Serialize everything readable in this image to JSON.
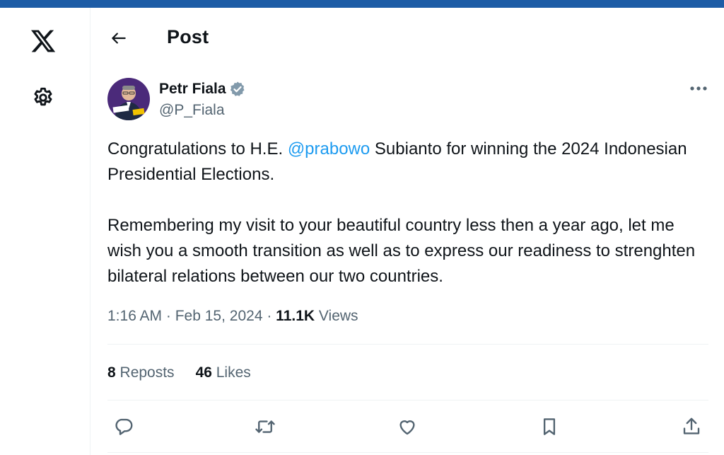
{
  "app": {
    "logo_icon": "x-logo-icon",
    "settings_icon": "gear-icon",
    "accent_color": "#1d9bf0",
    "topbar_color": "#1d5ca6"
  },
  "header": {
    "back_icon": "arrow-left-icon",
    "title": "Post"
  },
  "author": {
    "name": "Petr Fiala",
    "handle": "@P_Fiala",
    "verified": true,
    "verified_color": "#829aab"
  },
  "tweet": {
    "text_before_mention": "Congratulations to H.E. ",
    "mention": "@prabowo",
    "text_after_mention": " Subianto for winning the 2024 Indonesian Presidential Elections.",
    "paragraph_2": "Remembering my visit to your beautiful country less then a year ago, let me wish you a smooth transition as well as to express our readiness to strenghten bilateral relations between our two countries."
  },
  "meta": {
    "time": "1:16 AM",
    "separator": " · ",
    "date": "Feb 15, 2024",
    "views_count": "11.1K",
    "views_label": " Views"
  },
  "stats": {
    "reposts_count": "8",
    "reposts_label": " Reposts",
    "likes_count": "46",
    "likes_label": " Likes"
  },
  "actions": [
    "reply-icon",
    "repost-icon",
    "like-icon",
    "bookmark-icon",
    "share-icon"
  ]
}
